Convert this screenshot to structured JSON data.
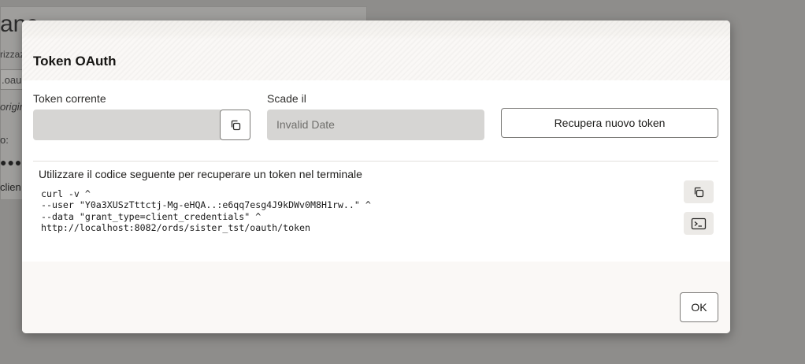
{
  "background": {
    "title": "anc",
    "sub": "rizzaz",
    "field_text": ".oau",
    "italic_text": "origin",
    "label2": "o:",
    "dots": "●●●●",
    "client": "clien"
  },
  "dialog": {
    "title": "Token OAuth",
    "current_token_label": "Token corrente",
    "current_token_value": "",
    "expires_label": "Scade il",
    "expires_value": "Invalid Date",
    "refresh_button": "Recupera nuovo token",
    "command_hint": "Utilizzare il codice seguente per recuperare un token nel terminale",
    "command": "curl -v ^\n--user \"Y0a3XUSzTttctj-Mg-eHQA..:e6qq7esg4J9kDWv0M8H1rw..\" ^\n--data \"grant_type=client_credentials\" ^\nhttp://localhost:8082/ords/sister_tst/oauth/token",
    "ok_button": "OK"
  },
  "icons": {
    "copy_token": "copy-icon",
    "copy_command": "copy-icon",
    "terminal": "terminal-icon"
  }
}
